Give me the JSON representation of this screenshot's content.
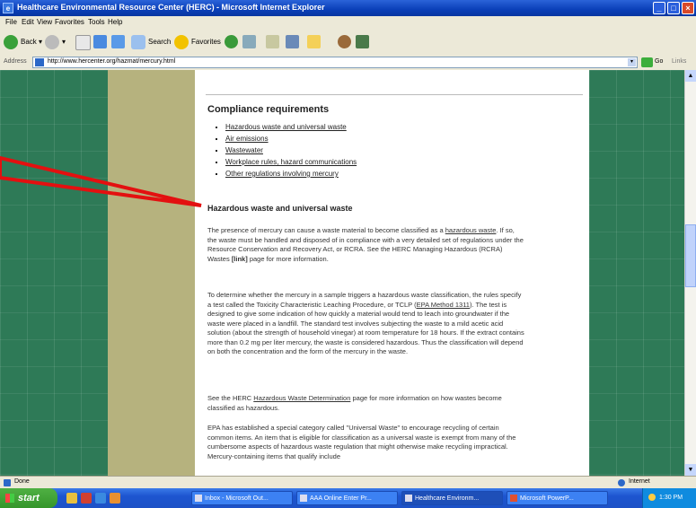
{
  "window": {
    "title": "Healthcare Environmental Resource Center (HERC) - Microsoft Internet Explorer"
  },
  "menu": [
    "File",
    "Edit",
    "View",
    "Favorites",
    "Tools",
    "Help"
  ],
  "toolbar": {
    "back": "Back",
    "search": "Search",
    "favorites": "Favorites"
  },
  "address": {
    "label": "Address",
    "url": "http://www.hercenter.org/hazmat/mercury.html",
    "go": "Go",
    "links": "Links"
  },
  "content": {
    "title": "Compliance requirements",
    "links": [
      "Hazardous waste and universal waste",
      "Air emissions",
      "Wastewater",
      "Workplace rules, hazard communications",
      "Other regulations involving mercury"
    ],
    "section_heading": "Hazardous waste and universal waste",
    "p1": {
      "a": "The presence of mercury can cause a waste material to become classified as a ",
      "link": "hazardous waste",
      "b": ". If so, the waste must be handled and disposed of in compliance with a very detailed set of regulations under the Resource Conservation and Recovery Act, or RCRA. See the HERC Managing Hazardous (RCRA) Wastes ",
      "bold": "[link]",
      "c": " page for more information."
    },
    "p2": {
      "a": "To determine whether the mercury in a sample triggers a hazardous waste classification, the rules specify a test called the Toxicity Characteristic Leaching Procedure, or TCLP (",
      "link": "EPA Method 1311",
      "b": "). The test is designed to give some indication of how quickly a material would tend to leach into groundwater if the waste were placed in a landfill. The standard test involves subjecting the waste to a mild acetic acid solution (about the strength of household vinegar) at room temperature for 18 hours. If the extract contains more than 0.2 mg per liter mercury, the waste is considered hazardous. Thus the classification will depend on both the concentration and the form of the mercury in the waste."
    },
    "p3": {
      "a": "See the HERC ",
      "link": "Hazardous Waste Determination",
      "b": " page for more information on how wastes become classified as hazardous."
    },
    "p4": "EPA has established a special category called \"Universal Waste\" to encourage recycling of certain common items. An item that is eligible for classification as a universal waste is exempt from many of the cumbersome aspects of hazardous waste regulation that might otherwise make recycling impractical. Mercury-containing items that qualify include"
  },
  "status": {
    "text": "Done",
    "zone": "Internet"
  },
  "taskbar": {
    "start": "start",
    "tasks": [
      "Inbox - Microsoft Out...",
      "AAA Online Enter Pr...",
      "Healthcare Environm...",
      "Microsoft PowerP..."
    ],
    "clock": "1:30 PM"
  },
  "colors": {
    "pointer": "#e31010",
    "page_bg": "#2f7a58",
    "sidebar": "#b6b27e"
  }
}
